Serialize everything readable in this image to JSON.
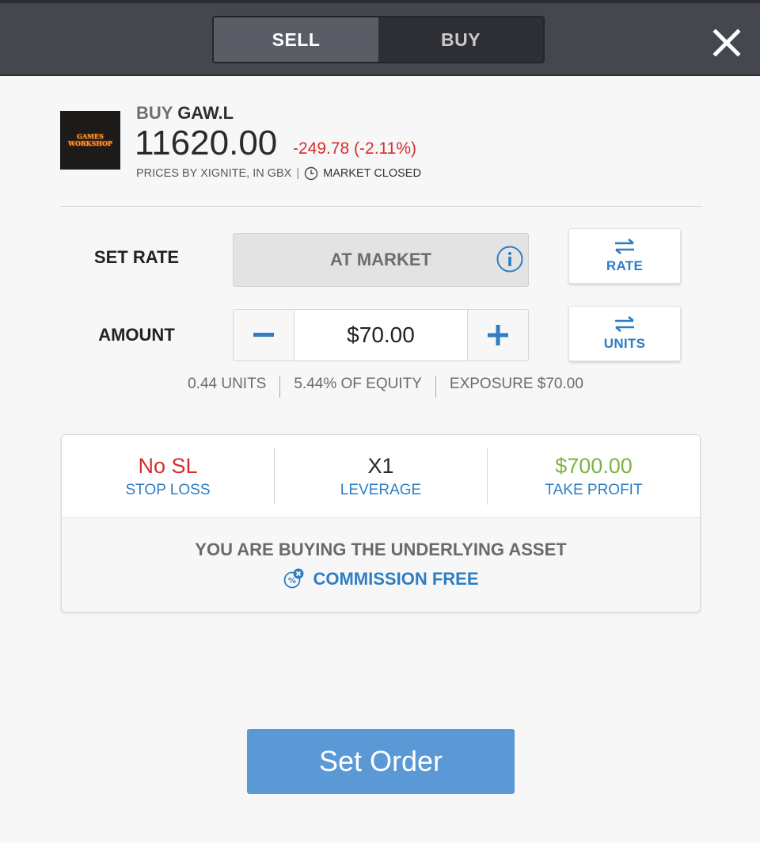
{
  "header": {
    "tabs": [
      "SELL",
      "BUY"
    ],
    "active_tab": "SELL"
  },
  "asset": {
    "logo_text": "GAMES WORKSHOP",
    "action": "BUY",
    "symbol": "GAW.L",
    "price": "11620.00",
    "change": "-249.78 (-2.11%)",
    "price_source": "PRICES BY XIGNITE, IN GBX",
    "separator": "|",
    "market_status": "MARKET CLOSED"
  },
  "rate": {
    "label": "SET RATE",
    "value": "AT MARKET",
    "toggle_label": "RATE"
  },
  "amount": {
    "label": "AMOUNT",
    "value": "$70.00",
    "toggle_label": "UNITS"
  },
  "stats": {
    "units": "0.44 UNITS",
    "equity": "5.44% OF EQUITY",
    "exposure": "EXPOSURE $70.00"
  },
  "order_settings": {
    "stop_loss_value": "No SL",
    "stop_loss_label": "STOP LOSS",
    "leverage_value": "X1",
    "leverage_label": "LEVERAGE",
    "take_profit_value": "$700.00",
    "take_profit_label": "TAKE PROFIT",
    "info_line": "YOU ARE BUYING THE UNDERLYING ASSET",
    "commission": "COMMISSION FREE"
  },
  "submit_label": "Set Order",
  "colors": {
    "negative": "#d32f2f",
    "positive": "#7cb342",
    "accent": "#2e7dc5",
    "button": "#5a98d6"
  }
}
